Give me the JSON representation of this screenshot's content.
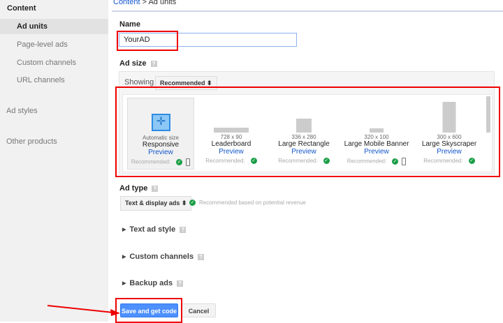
{
  "sidebar": {
    "section": "Content",
    "items": [
      {
        "label": "Ad units",
        "selected": true
      },
      {
        "label": "Page-level ads"
      },
      {
        "label": "Custom channels"
      },
      {
        "label": "URL channels"
      }
    ],
    "ad_styles": "Ad styles",
    "other_products": "Other products"
  },
  "breadcrumb": {
    "root": "Content",
    "sep": " > ",
    "current": "Ad units"
  },
  "name": {
    "label": "Name",
    "value": "YourAD"
  },
  "ad_size": {
    "label": "Ad size",
    "showing_label": "Showing",
    "filter": "Recommended",
    "cards": [
      {
        "dim": "Automatic size",
        "name": "Responsive",
        "preview": "Preview",
        "rec": "Recommended:",
        "mobile": true,
        "selected": true
      },
      {
        "dim": "728 x 90",
        "name": "Leaderboard",
        "preview": "Preview",
        "rec": "Recommended:",
        "mobile": false
      },
      {
        "dim": "336 x 280",
        "name": "Large Rectangle",
        "preview": "Preview",
        "rec": "Recommended:",
        "mobile": false
      },
      {
        "dim": "320 x 100",
        "name": "Large Mobile Banner",
        "preview": "Preview",
        "rec": "Recommended:",
        "mobile": true
      },
      {
        "dim": "300 x 600",
        "name": "Large Skyscraper",
        "preview": "Preview",
        "rec": "Recommended:",
        "mobile": false
      }
    ]
  },
  "ad_type": {
    "label": "Ad type",
    "value": "Text & display ads",
    "note": "Recommended based on potential revenue"
  },
  "sections": [
    "Text ad style",
    "Custom channels",
    "Backup ads"
  ],
  "buttons": {
    "save": "Save and get code",
    "cancel": "Cancel"
  },
  "colors": {
    "accent": "#4d90fe",
    "link": "#1155cc",
    "check": "#1a9e46",
    "highlight": "#ee0000"
  }
}
